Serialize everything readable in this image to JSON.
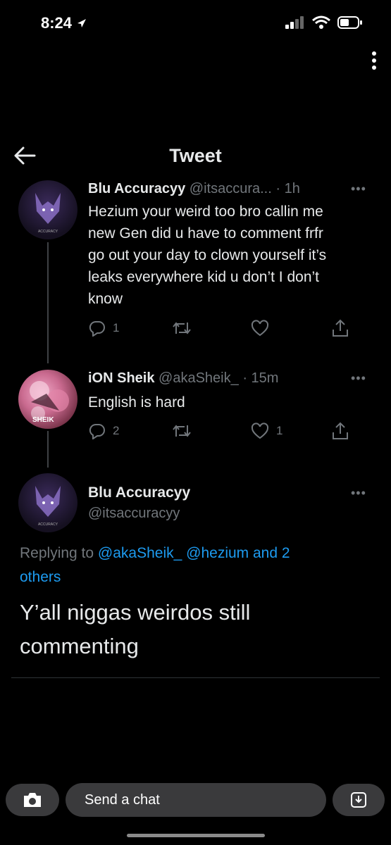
{
  "status": {
    "time": "8:24"
  },
  "header": {
    "title": "Tweet"
  },
  "tweets": [
    {
      "name": "Blu Accuracyy",
      "handle": "@itsaccura...",
      "time": "· 1h",
      "lines": [
        "Hezium your weird too bro callin me",
        "new Gen did u have to comment frfr",
        "go out your day to clown yourself it’s",
        "leaks everywhere kid u don’t I don’t",
        "know"
      ],
      "replies": "1",
      "retweets": "",
      "likes": ""
    },
    {
      "name": "iON Sheik",
      "handle": "@akaSheik_",
      "time": "· 15m",
      "text": "English is hard",
      "replies": "2",
      "retweets": "",
      "likes": "1"
    }
  ],
  "main_tweet": {
    "name": "Blu Accuracyy",
    "handle": "@itsaccuracyy",
    "replying_prefix": "Replying to",
    "mention_1": "@akaSheik_",
    "mention_2": "@hezium and 2",
    "mention_3": "others",
    "text_line_1": "Y’all niggas weirdos still",
    "text_line_2": "commenting"
  },
  "avatar_labels": {
    "blu": "ACCURACY",
    "sheik": "SHEIK"
  },
  "bottom_bar": {
    "chat_placeholder": "Send a chat"
  },
  "colors": {
    "link": "#1d9bf0",
    "muted": "#71767b",
    "text": "#e7e9ea"
  }
}
